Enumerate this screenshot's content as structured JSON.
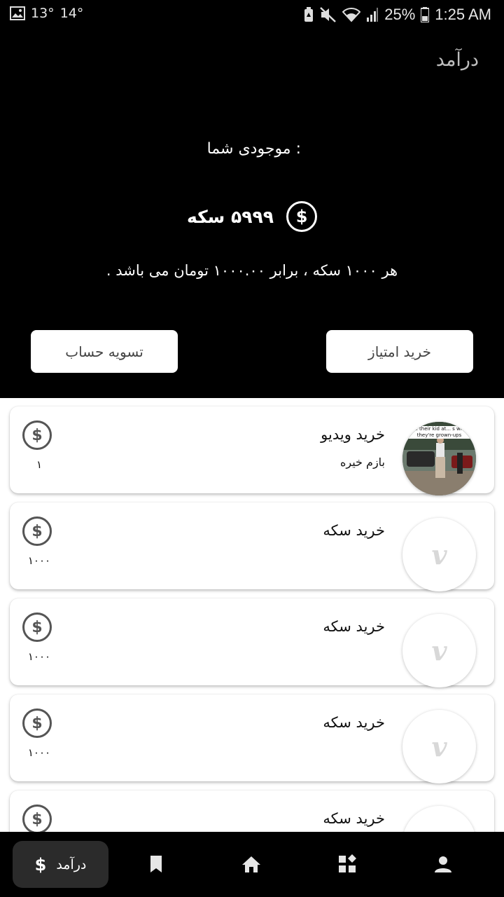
{
  "status_bar": {
    "temp1": "13°",
    "temp2": "14°",
    "battery": "25%",
    "time": "1:25 AM",
    "icons": [
      "image-icon",
      "battery-saver-icon",
      "mute-icon",
      "wifi-icon",
      "signal-icon",
      "battery-icon"
    ]
  },
  "header": {
    "title": "درآمد",
    "balance_label": "موجودی شما :",
    "balance_value": "۵۹۹۹ سکه",
    "rate_text": "هر ۱۰۰۰ سکه ، برابر ۱۰۰۰.۰۰ تومان می باشد .",
    "buy_button": "خرید امتیاز",
    "settle_button": "تسویه حساب"
  },
  "transactions": [
    {
      "title": "خرید ویدیو",
      "subtitle": "بازم خیره",
      "amount": "۱",
      "thumb": "video",
      "caption": "ave their kid at... s when they're grown-ups"
    },
    {
      "title": "خرید سکه",
      "subtitle": "",
      "amount": "۱۰۰۰",
      "thumb": "logo"
    },
    {
      "title": "خرید سکه",
      "subtitle": "",
      "amount": "۱۰۰۰",
      "thumb": "logo"
    },
    {
      "title": "خرید سکه",
      "subtitle": "",
      "amount": "۱۰۰۰",
      "thumb": "logo"
    },
    {
      "title": "خرید سکه",
      "subtitle": "",
      "amount": "",
      "thumb": "logo"
    }
  ],
  "logo_glyph": "v",
  "coin_glyph": "$",
  "bottom_nav": {
    "active_label": "درآمد",
    "items": [
      "dollar-icon",
      "bookmark-icon",
      "home-icon",
      "apps-icon",
      "profile-icon"
    ]
  }
}
